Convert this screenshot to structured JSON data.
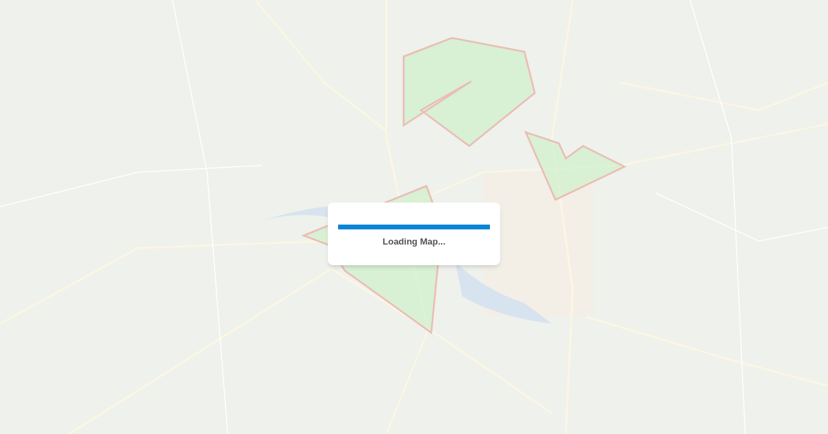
{
  "loader": {
    "text": "Loading Map...",
    "level": 1
  }
}
